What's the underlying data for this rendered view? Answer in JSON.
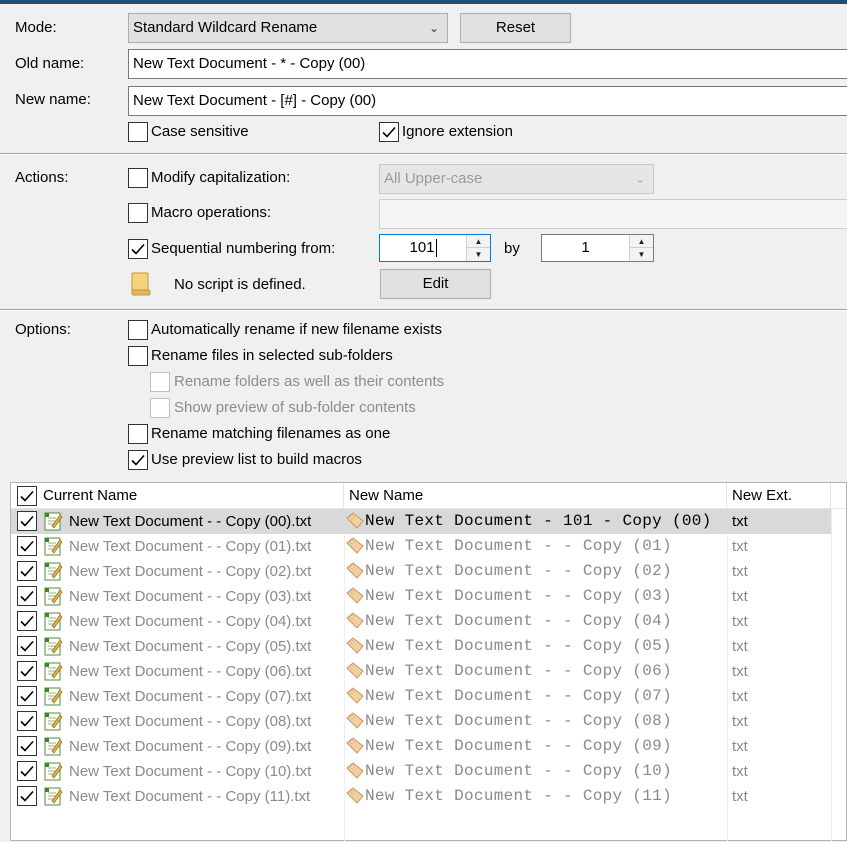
{
  "mode": {
    "label": "Mode:",
    "value": "Standard Wildcard Rename",
    "reset_label": "Reset"
  },
  "old_name": {
    "label": "Old name:",
    "value": "New Text Document - * - Copy (00)"
  },
  "new_name": {
    "label": "New name:",
    "value": "New Text Document - [#] - Copy (00)"
  },
  "case_sensitive": {
    "label": "Case sensitive",
    "checked": false
  },
  "ignore_extension": {
    "label": "Ignore extension",
    "checked": true
  },
  "actions": {
    "label": "Actions:",
    "modify_capitalization": {
      "label": "Modify capitalization:",
      "checked": false,
      "option": "All Upper-case"
    },
    "macro_operations": {
      "label": "Macro operations:",
      "checked": false,
      "value": ""
    },
    "sequential_numbering": {
      "label": "Sequential numbering from:",
      "checked": true,
      "from": "101",
      "by_label": "by",
      "by": "1"
    },
    "script": {
      "text": "No script is defined.",
      "edit_label": "Edit"
    }
  },
  "options": {
    "label": "Options:",
    "auto_rename": {
      "label": "Automatically rename if new filename exists",
      "checked": false
    },
    "rename_subfolders": {
      "label": "Rename files in selected sub-folders",
      "checked": false
    },
    "rename_folders_contents": {
      "label": "Rename folders as well as their contents",
      "checked": false,
      "enabled": false
    },
    "show_preview_subfolders": {
      "label": "Show preview of sub-folder contents",
      "checked": false,
      "enabled": false
    },
    "rename_matching": {
      "label": "Rename matching filenames as one",
      "checked": false
    },
    "use_preview_list": {
      "label": "Use preview list to build macros",
      "checked": true
    }
  },
  "list": {
    "columns": {
      "current": "Current Name",
      "new": "New Name",
      "ext": "New Ext."
    },
    "rows": [
      {
        "current": "New Text Document -  - Copy (00).txt",
        "new": "New Text Document - 101 - Copy (00)",
        "ext": "txt",
        "selected": true
      },
      {
        "current": "New Text Document -  - Copy (01).txt",
        "new": "New Text Document -  - Copy (01)",
        "ext": "txt"
      },
      {
        "current": "New Text Document -  - Copy (02).txt",
        "new": "New Text Document -  - Copy (02)",
        "ext": "txt"
      },
      {
        "current": "New Text Document -  - Copy (03).txt",
        "new": "New Text Document -  - Copy (03)",
        "ext": "txt"
      },
      {
        "current": "New Text Document -  - Copy (04).txt",
        "new": "New Text Document -  - Copy (04)",
        "ext": "txt"
      },
      {
        "current": "New Text Document -  - Copy (05).txt",
        "new": "New Text Document -  - Copy (05)",
        "ext": "txt"
      },
      {
        "current": "New Text Document -  - Copy (06).txt",
        "new": "New Text Document -  - Copy (06)",
        "ext": "txt"
      },
      {
        "current": "New Text Document -  - Copy (07).txt",
        "new": "New Text Document -  - Copy (07)",
        "ext": "txt"
      },
      {
        "current": "New Text Document -  - Copy (08).txt",
        "new": "New Text Document -  - Copy (08)",
        "ext": "txt"
      },
      {
        "current": "New Text Document -  - Copy (09).txt",
        "new": "New Text Document -  - Copy (09)",
        "ext": "txt"
      },
      {
        "current": "New Text Document -  - Copy (10).txt",
        "new": "New Text Document -  - Copy (10)",
        "ext": "txt"
      },
      {
        "current": "New Text Document -  - Copy (11).txt",
        "new": "New Text Document -  - Copy (11)",
        "ext": "txt"
      }
    ]
  },
  "icons": {
    "checkmark": "checkmark-icon",
    "file": "text-file-icon",
    "tag": "tag-icon",
    "script": "script-note-icon",
    "dropdown": "chevron-down-icon"
  },
  "colors": {
    "accent": "#1f4e79",
    "focus": "#0078d7",
    "selected_row": "#d9d9d9",
    "disabled_text": "#8c8c8c"
  }
}
